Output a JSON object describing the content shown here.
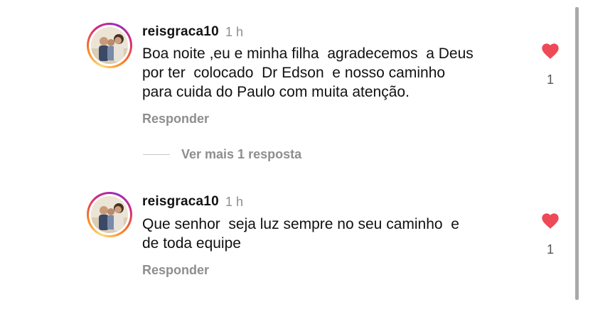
{
  "comments": [
    {
      "username": "reisgraca10",
      "time": "1 h",
      "text": "Boa noite ,eu e minha filha  agradecemos  a Deus\npor ter  colocado  Dr Edson  e nosso caminho\npara cuida do Paulo com muita atenção.",
      "reply_label": "Responder",
      "likes": "1",
      "more_replies_label": "Ver mais 1 resposta"
    },
    {
      "username": "reisgraca10",
      "time": "1 h",
      "text": "Que senhor  seja luz sempre no seu caminho  e\nde toda equipe",
      "reply_label": "Responder",
      "likes": "1"
    }
  ],
  "colors": {
    "like": "#ed4956",
    "muted": "#8e8e8e",
    "text": "#111111"
  },
  "icons": {
    "like": "heart-icon"
  }
}
